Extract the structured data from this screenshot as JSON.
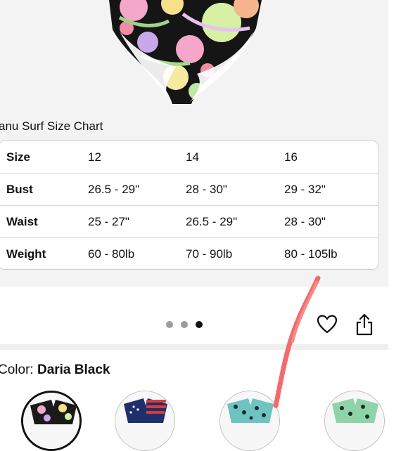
{
  "size_chart": {
    "title": "anu Surf Size Chart",
    "rows": [
      {
        "label": "Size",
        "values": [
          "12",
          "14",
          "16"
        ]
      },
      {
        "label": "Bust",
        "values": [
          "26.5 - 29\"",
          "28 - 30\"",
          "29 - 32\""
        ]
      },
      {
        "label": "Waist",
        "values": [
          "25 - 27\"",
          "26.5 - 29\"",
          "28 - 30\""
        ]
      },
      {
        "label": "Weight",
        "values": [
          "60 - 80lb",
          "70 - 90lb",
          "80 - 105lb"
        ]
      }
    ]
  },
  "gallery": {
    "page_count": 3,
    "active_page": 3
  },
  "actions": {
    "favorite_icon": "heart-icon",
    "share_icon": "share-icon"
  },
  "color_selector": {
    "prefix": "Color: ",
    "selected_name": "Daria Black",
    "swatches": [
      {
        "name": "floral-black",
        "selected": true
      },
      {
        "name": "flag-print",
        "selected": false
      },
      {
        "name": "leopard-teal",
        "selected": false
      },
      {
        "name": "leopard-green",
        "selected": false
      }
    ]
  },
  "colors": {
    "accent_annotation": "#f26b6b",
    "active_dot": "#111111",
    "inactive_dot": "#9c9c9c"
  }
}
